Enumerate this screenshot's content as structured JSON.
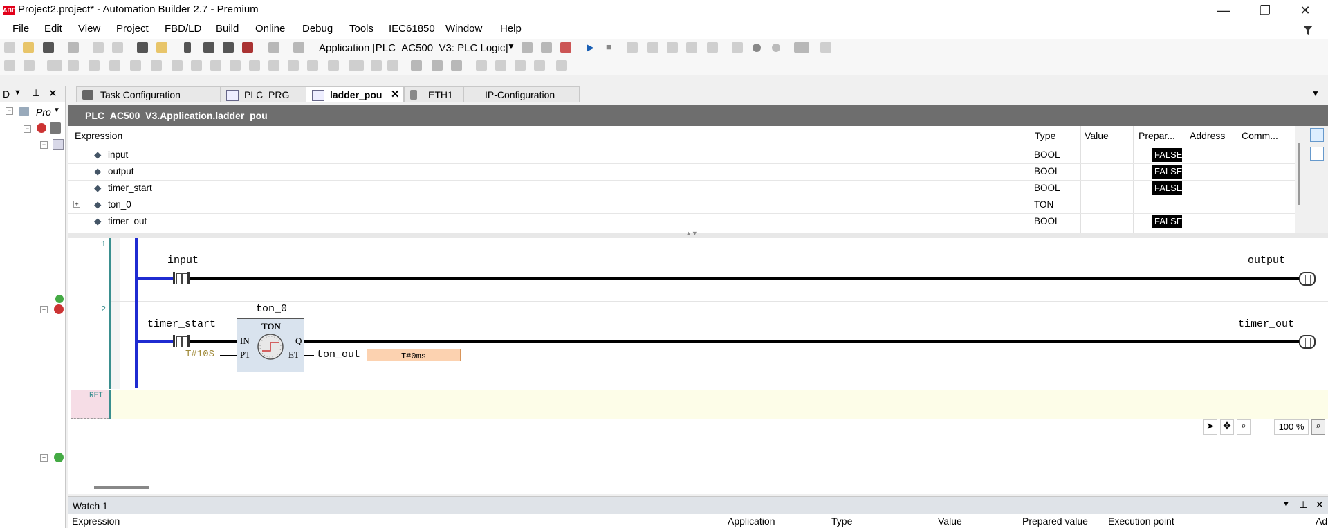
{
  "window": {
    "logo": "ABB",
    "title": "Project2.project* - Automation Builder 2.7 - Premium",
    "minimize": "—",
    "restore": "❐",
    "close": "✕"
  },
  "menu": [
    "File",
    "Edit",
    "View",
    "Project",
    "FBD/LD",
    "Build",
    "Online",
    "Debug",
    "Tools",
    "IEC61850",
    "Window",
    "Help"
  ],
  "toolbar": {
    "app_selector": "Application [PLC_AC500_V3: PLC Logic]"
  },
  "left_panel": {
    "tree_label": "Pro"
  },
  "tabs": [
    {
      "label": "Task Configuration",
      "active": false
    },
    {
      "label": "PLC_PRG",
      "active": false
    },
    {
      "label": "ladder_pou",
      "active": true
    },
    {
      "label": "ETH1",
      "active": false
    },
    {
      "label": "IP-Configuration",
      "active": false
    }
  ],
  "pou_header": "PLC_AC500_V3.Application.ladder_pou",
  "var_table": {
    "columns": [
      "Expression",
      "Type",
      "Value",
      "Prepar...",
      "Address",
      "Comm..."
    ],
    "rows": [
      {
        "name": "input",
        "type": "BOOL",
        "value": "FALSE",
        "expandable": false
      },
      {
        "name": "output",
        "type": "BOOL",
        "value": "FALSE",
        "expandable": false
      },
      {
        "name": "timer_start",
        "type": "BOOL",
        "value": "FALSE",
        "expandable": false
      },
      {
        "name": "ton_0",
        "type": "TON",
        "value": "",
        "expandable": true
      },
      {
        "name": "timer_out",
        "type": "BOOL",
        "value": "FALSE",
        "expandable": false
      }
    ]
  },
  "ladder": {
    "network1": {
      "number": "1",
      "contact": "input",
      "coil": "output"
    },
    "network2": {
      "number": "2",
      "instance": "ton_0",
      "contact": "timer_start",
      "coil": "timer_out",
      "fb_type": "TON",
      "pin_in": "IN",
      "pin_pt": "PT",
      "pin_q": "Q",
      "pin_et": "ET",
      "pt_value": "T#10S",
      "et_var": "ton_out",
      "et_value": "T#0ms"
    },
    "ret_label": "RET"
  },
  "zoom": "100 %",
  "watch": {
    "title": "Watch 1",
    "columns": [
      "Expression",
      "Application",
      "Type",
      "Value",
      "Prepared value",
      "Execution point",
      "Ad"
    ]
  },
  "colors": {
    "rail_blue": "#1f2bd1",
    "header_gray": "#6e6e6e",
    "value_bg": "#000000",
    "et_box": "#fcd2b0",
    "ret_bg": "#f6dde6",
    "ret_row": "#fdfde8"
  }
}
